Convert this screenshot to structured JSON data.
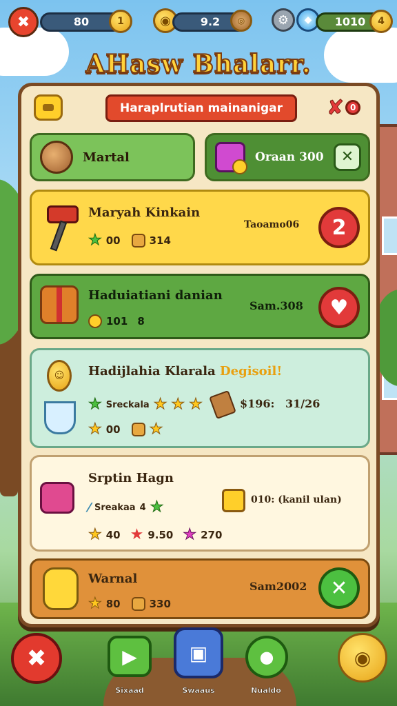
{
  "hud": {
    "back_icon": "back-arrow-icon",
    "bar1_value": "80",
    "bar1_badge": "1",
    "bar2_value": "9.2",
    "bar3_value": "1010",
    "bar3_badge": "4"
  },
  "title": "AHasw Bhalarr.",
  "panel": {
    "header_title": "Haraplrutian mainanigar",
    "close_badge": "0",
    "left_tab": "Martal",
    "right_tab": "Oraan 300"
  },
  "items": [
    {
      "name": "Maryah Kinkain",
      "price": "Taoamo06",
      "stat1": "00",
      "stat2": "314",
      "action": "2"
    },
    {
      "name": "Haduiatiani danian",
      "price": "Sam.308",
      "stat1": "101",
      "stat2": "8",
      "action": "♥"
    },
    {
      "name": "Hadijlahia Klarala",
      "highlight": "Degisoil!",
      "price": "$196:",
      "price2": "31/26",
      "tag": "Sreckala",
      "stat1": "00"
    },
    {
      "name": "Srptin Hagn",
      "price": "010: (kanil ulan)",
      "tag": "Sreakaa",
      "tag_num": "4",
      "stat1": "40",
      "stat2": "9.50",
      "stat3": "270"
    },
    {
      "name": "Warnal",
      "price": "Sam2002",
      "stat1": "80",
      "stat2": "330"
    }
  ],
  "nav": {
    "play_label": "Sixaad",
    "shop_label": "Swaaus",
    "green_label": "Nualdo"
  },
  "colors": {
    "accent": "#ffcf2a",
    "danger": "#e23a3a",
    "green": "#6db84a",
    "panel": "#f6e7c4"
  }
}
